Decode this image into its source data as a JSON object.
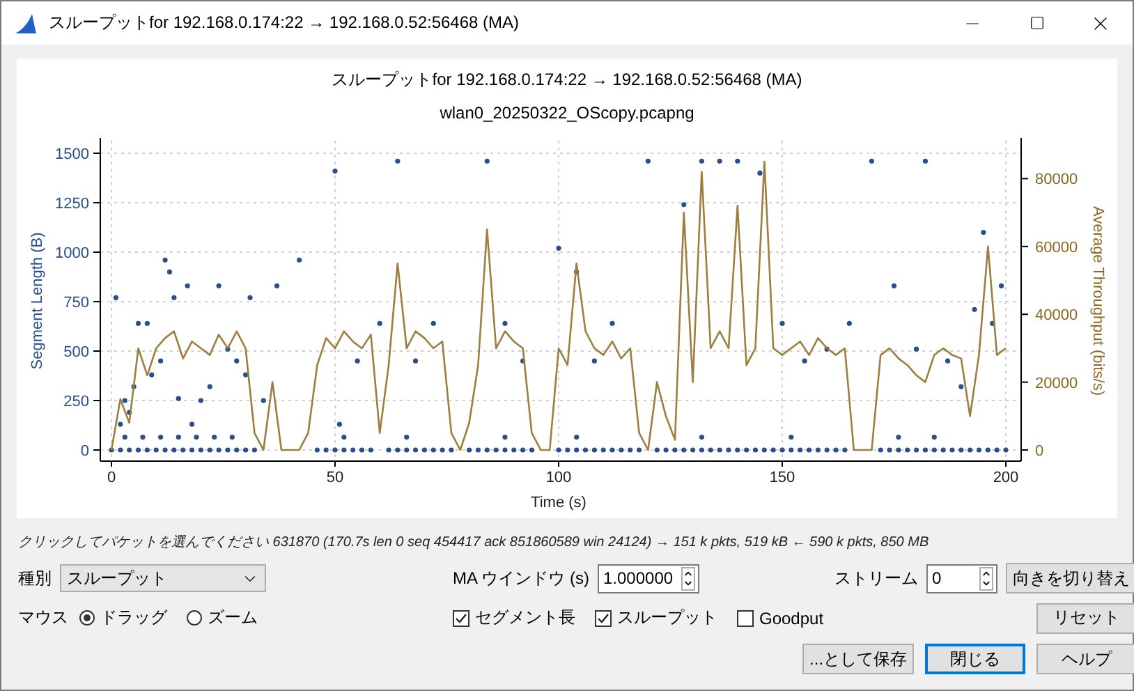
{
  "window": {
    "title": "スループットfor 192.168.0.174:22 → 192.168.0.52:56468 (MA)"
  },
  "chart": {
    "title": "スループットfor 192.168.0.174:22 → 192.168.0.52:56468 (MA)",
    "subtitle": "wlan0_20250322_OScopy.pcapng",
    "chart_data": {
      "type": "scatter",
      "grid": true,
      "xlabel": "Time (s)",
      "ylabel": "Segment Length (B)",
      "y2label": "Average Throughput (bits/s)",
      "xlim": [
        0,
        200
      ],
      "ylim": [
        0,
        1500
      ],
      "y2lim": [
        0,
        92000
      ],
      "xticks": [
        0,
        50,
        100,
        150,
        200
      ],
      "yticks": [
        0,
        250,
        500,
        750,
        1000,
        1250,
        1500
      ],
      "y2ticks": [
        0,
        20000,
        40000,
        60000,
        80000
      ],
      "series": [
        {
          "type": "scatter",
          "color": "#2b4f8a",
          "x": [
            1,
            2,
            3,
            4,
            5,
            6,
            8,
            9,
            11,
            12,
            13,
            14,
            15,
            17,
            18,
            20,
            22,
            24,
            26,
            28,
            30,
            31,
            34,
            37,
            42,
            50,
            51,
            55,
            60,
            64,
            68,
            72,
            84,
            88,
            92,
            100,
            104,
            108,
            112,
            120,
            128,
            132,
            136,
            140,
            145,
            150,
            155,
            160,
            165,
            170,
            175,
            180,
            182,
            187,
            190,
            193,
            195,
            197,
            199,
            3,
            7,
            11,
            15,
            19,
            23,
            27,
            52,
            66,
            88,
            104,
            132,
            152,
            176,
            184,
            0,
            2,
            4,
            6,
            8,
            10,
            12,
            14,
            16,
            18,
            20,
            22,
            24,
            26,
            28,
            30,
            32,
            46,
            48,
            50,
            52,
            54,
            56,
            58,
            62,
            64,
            66,
            68,
            70,
            72,
            74,
            76,
            80,
            82,
            84,
            86,
            88,
            90,
            92,
            94,
            100,
            102,
            104,
            106,
            108,
            110,
            112,
            114,
            116,
            118,
            122,
            124,
            126,
            128,
            130,
            132,
            134,
            136,
            138,
            140,
            142,
            144,
            146,
            148,
            150,
            152,
            154,
            156,
            158,
            160,
            162,
            164,
            172,
            174,
            176,
            178,
            180,
            182,
            184,
            186,
            188,
            190,
            192,
            194,
            196,
            198,
            200
          ],
          "values": [
            770,
            130,
            250,
            190,
            320,
            640,
            640,
            380,
            450,
            960,
            900,
            770,
            260,
            830,
            130,
            250,
            320,
            830,
            510,
            450,
            380,
            770,
            250,
            830,
            960,
            1410,
            130,
            450,
            640,
            1460,
            450,
            640,
            1460,
            640,
            450,
            1020,
            900,
            450,
            640,
            1460,
            1240,
            1460,
            1460,
            1460,
            1400,
            640,
            450,
            510,
            640,
            1460,
            830,
            510,
            1460,
            450,
            320,
            710,
            1100,
            640,
            830,
            65,
            65,
            65,
            65,
            65,
            65,
            65,
            65,
            65,
            65,
            65,
            65,
            65,
            65,
            65,
            0,
            0,
            0,
            0,
            0,
            0,
            0,
            0,
            0,
            0,
            0,
            0,
            0,
            0,
            0,
            0,
            0,
            0,
            0,
            0,
            0,
            0,
            0,
            0,
            0,
            0,
            0,
            0,
            0,
            0,
            0,
            0,
            0,
            0,
            0,
            0,
            0,
            0,
            0,
            0,
            0,
            0,
            0,
            0,
            0,
            0,
            0,
            0,
            0,
            0,
            0,
            0,
            0,
            0,
            0,
            0,
            0,
            0,
            0,
            0,
            0,
            0,
            0,
            0,
            0,
            0,
            0,
            0,
            0,
            0,
            0,
            0,
            0,
            0,
            0,
            0,
            0,
            0,
            0,
            0,
            0,
            0,
            0,
            0,
            0,
            0,
            0
          ]
        },
        {
          "type": "line",
          "axis": "y2",
          "color": "#9c7f3f",
          "x": [
            0,
            2,
            4,
            6,
            8,
            10,
            12,
            14,
            16,
            18,
            20,
            22,
            24,
            26,
            28,
            30,
            32,
            34,
            36,
            38,
            40,
            42,
            44,
            46,
            48,
            50,
            52,
            54,
            56,
            58,
            60,
            62,
            64,
            66,
            68,
            70,
            72,
            74,
            76,
            78,
            80,
            82,
            84,
            86,
            88,
            90,
            92,
            94,
            96,
            98,
            100,
            102,
            104,
            106,
            108,
            110,
            112,
            114,
            116,
            118,
            120,
            122,
            124,
            126,
            128,
            130,
            132,
            134,
            136,
            138,
            140,
            142,
            144,
            146,
            148,
            150,
            152,
            154,
            156,
            158,
            160,
            162,
            164,
            166,
            168,
            170,
            172,
            174,
            176,
            178,
            180,
            182,
            184,
            186,
            188,
            190,
            192,
            194,
            196,
            198,
            200
          ],
          "values": [
            0,
            15000,
            8000,
            30000,
            22000,
            30000,
            33000,
            35000,
            27000,
            32000,
            30000,
            28000,
            34000,
            30000,
            35000,
            30000,
            5000,
            0,
            20000,
            0,
            0,
            0,
            5000,
            25000,
            33000,
            30000,
            35000,
            32000,
            30000,
            34000,
            5000,
            25000,
            55000,
            30000,
            35000,
            33000,
            30000,
            32000,
            5000,
            0,
            8000,
            25000,
            65000,
            30000,
            35000,
            32000,
            30000,
            5000,
            0,
            0,
            30000,
            25000,
            55000,
            35000,
            30000,
            28000,
            32000,
            27000,
            30000,
            5000,
            0,
            20000,
            10000,
            3000,
            70000,
            20000,
            82000,
            30000,
            35000,
            30000,
            72000,
            25000,
            30000,
            85000,
            30000,
            28000,
            30000,
            32000,
            28000,
            33000,
            30000,
            28000,
            30000,
            0,
            0,
            0,
            28000,
            30000,
            27000,
            25000,
            22000,
            20000,
            28000,
            30000,
            28000,
            27000,
            10000,
            28000,
            60000,
            28000,
            30000
          ]
        }
      ]
    }
  },
  "status_text": "クリックしてパケットを選んでください 631870 (170.7s len 0 seq 454417 ack 851860589 win 24124) → 151 k pkts, 519 kB ← 590 k pkts, 850 MB",
  "controls": {
    "type_label": "種別",
    "type_value": "スループット",
    "ma_label": "MA ウインドウ (s)",
    "ma_value": "1.000000",
    "stream_label": "ストリーム",
    "stream_value": "0",
    "switch_direction": "向きを切り替え",
    "mouse_label": "マウス",
    "mouse_modes": [
      {
        "label": "ドラッグ",
        "selected": true
      },
      {
        "label": "ズーム",
        "selected": false
      }
    ],
    "toggles": [
      {
        "label": "セグメント長",
        "checked": true
      },
      {
        "label": "スループット",
        "checked": true
      },
      {
        "label": "Goodput",
        "checked": false
      }
    ],
    "reset": "リセット"
  },
  "buttons": [
    {
      "label": "...として保存",
      "focused": false
    },
    {
      "label": "閉じる",
      "focused": true
    },
    {
      "label": "ヘルプ",
      "focused": false
    }
  ]
}
